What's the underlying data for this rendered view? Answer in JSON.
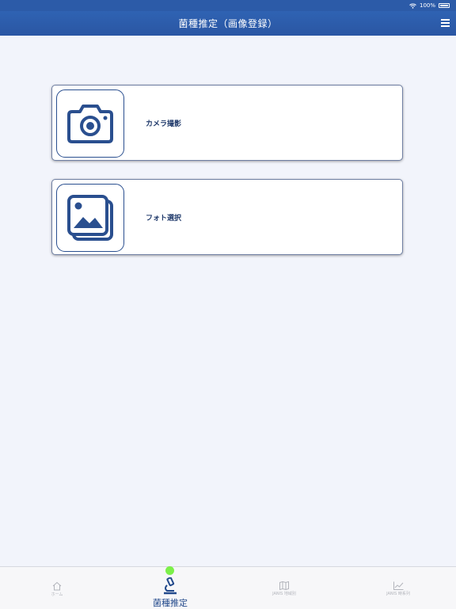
{
  "status_bar": {
    "battery": "100%"
  },
  "nav": {
    "title": "菌種推定（画像登録）"
  },
  "options": [
    {
      "label": "カメラ撮影",
      "icon": "camera-icon"
    },
    {
      "label": "フォト選択",
      "icon": "photo-gallery-icon"
    }
  ],
  "tabs": [
    {
      "label": "ホーム",
      "icon": "home-icon"
    },
    {
      "label": "菌種推定",
      "icon": "microscope-icon",
      "active": true
    },
    {
      "label": "JANIS 地域別",
      "icon": "map-icon"
    },
    {
      "label": "JANIS 時系列",
      "icon": "chart-icon"
    }
  ],
  "colors": {
    "accent": "#2c5ba8",
    "icon": "#2a4f8f",
    "active_dot": "#7cf04a"
  }
}
